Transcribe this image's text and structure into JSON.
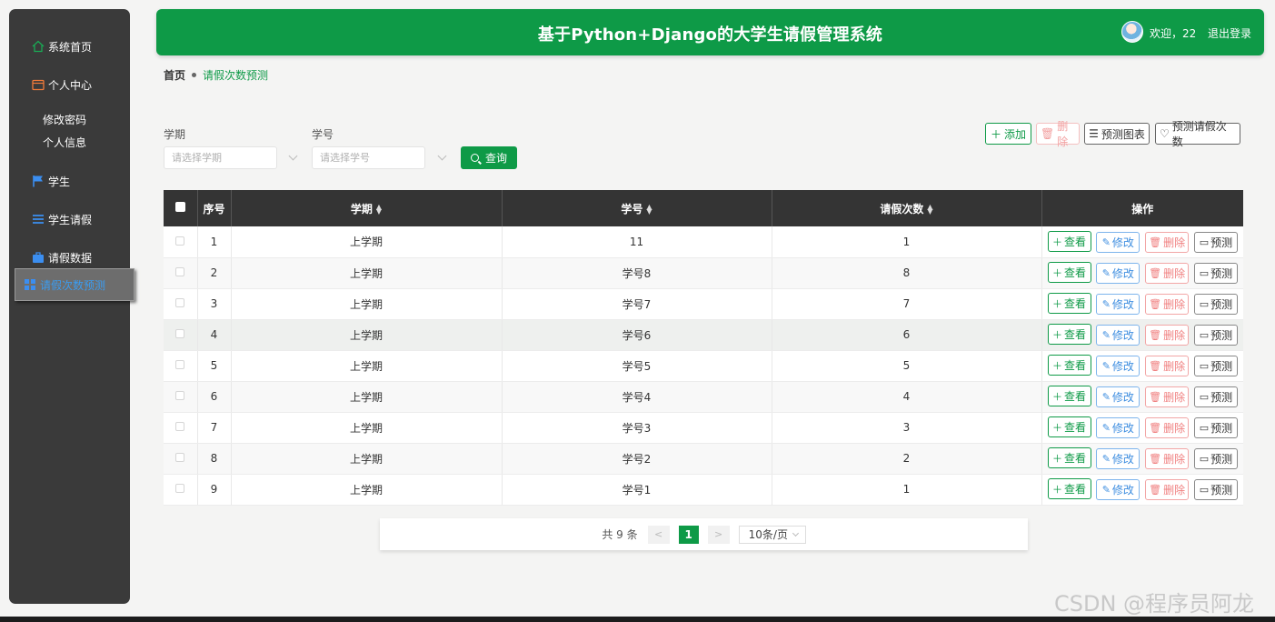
{
  "app": {
    "title": "基于Python+Django的大学生请假管理系统",
    "welcome": "欢迎，22",
    "logout": "退出登录"
  },
  "sidebar": {
    "home": "系统首页",
    "personal_center": "个人中心",
    "change_password": "修改密码",
    "personal_info": "个人信息",
    "student": "学生",
    "student_leave": "学生请假",
    "leave_data": "请假数据",
    "leave_count_predict": "请假次数预测"
  },
  "breadcrumb": {
    "home": "首页",
    "current": "请假次数预测"
  },
  "search": {
    "semester_label": "学期",
    "semester_placeholder": "请选择学期",
    "student_no_label": "学号",
    "student_no_placeholder": "请选择学号",
    "query_button": "查询"
  },
  "toolbar": {
    "add": "添加",
    "delete": "删除",
    "chart": "预测图表",
    "predict_count": "预测请假次数"
  },
  "table": {
    "headers": {
      "index": "序号",
      "semester": "学期",
      "student_no": "学号",
      "leave_count": "请假次数",
      "actions": "操作"
    },
    "action_labels": {
      "view": "查看",
      "edit": "修改",
      "delete": "删除",
      "predict": "预测"
    },
    "rows": [
      {
        "index": "1",
        "semester": "上学期",
        "student_no": "11",
        "leave_count": "1"
      },
      {
        "index": "2",
        "semester": "上学期",
        "student_no": "学号8",
        "leave_count": "8"
      },
      {
        "index": "3",
        "semester": "上学期",
        "student_no": "学号7",
        "leave_count": "7"
      },
      {
        "index": "4",
        "semester": "上学期",
        "student_no": "学号6",
        "leave_count": "6"
      },
      {
        "index": "5",
        "semester": "上学期",
        "student_no": "学号5",
        "leave_count": "5"
      },
      {
        "index": "6",
        "semester": "上学期",
        "student_no": "学号4",
        "leave_count": "4"
      },
      {
        "index": "7",
        "semester": "上学期",
        "student_no": "学号3",
        "leave_count": "3"
      },
      {
        "index": "8",
        "semester": "上学期",
        "student_no": "学号2",
        "leave_count": "2"
      },
      {
        "index": "9",
        "semester": "上学期",
        "student_no": "学号1",
        "leave_count": "1"
      }
    ]
  },
  "pagination": {
    "total": "共 9 条",
    "prev": "<",
    "current_page": "1",
    "next": ">",
    "page_size": "10条/页"
  },
  "watermark": "CSDN @程序员阿龙",
  "colors": {
    "primary": "#0e9a47",
    "sidebar": "#3a3a3a",
    "header_th": "#343434",
    "active_menu_text": "#3b9cf0"
  }
}
